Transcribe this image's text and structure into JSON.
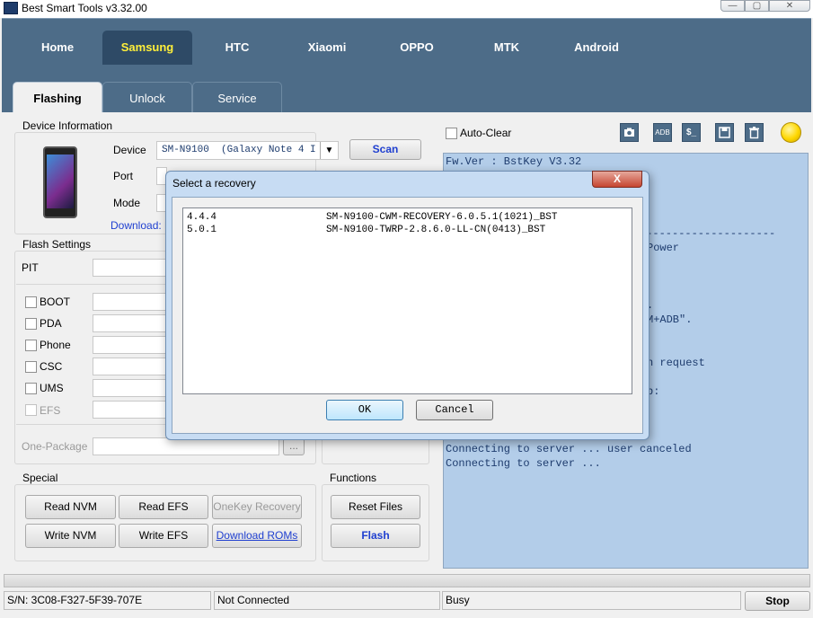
{
  "window": {
    "title": "Best Smart Tools v3.32.00",
    "minimize": "—",
    "maximize": "▢",
    "close": "✕"
  },
  "main_tabs": [
    {
      "label": "Home",
      "active": false
    },
    {
      "label": "Samsung",
      "active": true
    },
    {
      "label": "HTC",
      "active": false
    },
    {
      "label": "Xiaomi",
      "active": false
    },
    {
      "label": "OPPO",
      "active": false
    },
    {
      "label": "MTK",
      "active": false
    },
    {
      "label": "Android",
      "active": false
    }
  ],
  "sub_tabs": [
    {
      "label": "Flashing",
      "active": true
    },
    {
      "label": "Unlock",
      "active": false
    },
    {
      "label": "Service",
      "active": false
    }
  ],
  "device_info": {
    "legend": "Device Information",
    "device_label": "Device",
    "device_value": "SM-N9100  (Galaxy Note 4 I",
    "port_label": "Port",
    "mode_label": "Mode",
    "download_link": "Download: P",
    "scan_button": "Scan"
  },
  "flash_settings": {
    "legend": "Flash Settings",
    "pit_label": "PIT",
    "items": [
      {
        "label": "BOOT",
        "enabled": true
      },
      {
        "label": "PDA",
        "enabled": true
      },
      {
        "label": "Phone",
        "enabled": true
      },
      {
        "label": "CSC",
        "enabled": true
      },
      {
        "label": "UMS",
        "enabled": true
      },
      {
        "label": "EFS",
        "enabled": false
      }
    ],
    "one_package_label": "One-Package",
    "browse_label": "..."
  },
  "special": {
    "legend": "Special",
    "buttons": [
      "Read NVM",
      "Read EFS",
      "OneKey Recovery",
      "Write NVM",
      "Write EFS",
      "Download ROMs"
    ]
  },
  "functions": {
    "legend": "Functions",
    "reset_files": "Reset Files",
    "flash": "Flash"
  },
  "log_panel": {
    "auto_clear_label": "Auto-Clear",
    "tool_icons": [
      "camera-icon",
      "adb-icon",
      "shell-icon",
      "save-icon",
      "trash-icon"
    ],
    "adb_label": "ADB",
    "shell_label": "$_",
    "status_color": "#ffd700",
    "lines": [
      "Fw.Ver : BstKey V3.32",
      "Connecting to server ... user canceled",
      "Connecting to server ..."
    ],
    "partial_fragments": [
      "---------------------",
      "Power",
      ".",
      "M+ADB\".",
      "n request",
      "p:"
    ]
  },
  "dialog": {
    "title": "Select a recovery",
    "close": "X",
    "items": [
      {
        "version": "4.4.4",
        "name": "SM-N9100-CWM-RECOVERY-6.0.5.1(1021)_BST"
      },
      {
        "version": "5.0.1",
        "name": "SM-N9100-TWRP-2.8.6.0-LL-CN(0413)_BST"
      }
    ],
    "ok_label": "OK",
    "cancel_label": "Cancel"
  },
  "status_bar": {
    "serial": "S/N: 3C08-F327-5F39-707E",
    "connection": "Not Connected",
    "state": "Busy",
    "stop_label": "Stop"
  },
  "colors": {
    "tab_bar": "#4d6c88",
    "active_tab_text": "#ffef3a",
    "log_bg": "#b3cde9",
    "link": "#1f3fd0"
  }
}
